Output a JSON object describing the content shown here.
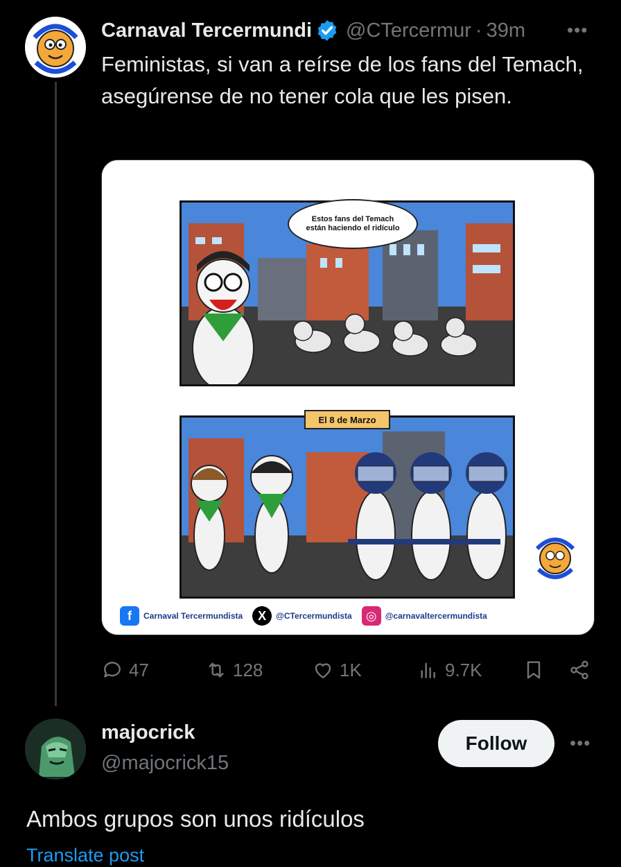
{
  "post": {
    "display_name": "Carnaval Tercermundista",
    "handle": "@CTercermur",
    "separator": "·",
    "time": "39m",
    "text": "Feministas, si van a reírse de los fans del Temach, asegúrense de no tener cola que les pisen.",
    "avatar_icon": "carnaval-logo-avatar",
    "verified_icon": "verified-badge-icon",
    "media": {
      "bubble_text": "Estos fans del Temach están haciendo el ridículo",
      "date_tag": "El 8 de Marzo",
      "social": [
        {
          "icon": "facebook-icon",
          "label": "Carnaval Tercermundista"
        },
        {
          "icon": "x-logo-icon",
          "label": "@CTercermundista"
        },
        {
          "icon": "instagram-icon",
          "label": "@carnavaltercermundista"
        }
      ]
    },
    "actions": {
      "replies": "47",
      "reposts": "128",
      "likes": "1K",
      "views": "9.7K"
    }
  },
  "reply": {
    "display_name": "majocrick",
    "handle": "@majocrick15",
    "follow_label": "Follow",
    "text": "Ambos grupos son unos ridículos",
    "translate_label": "Translate post",
    "avatar_icon": "green-character-avatar"
  },
  "colors": {
    "background": "#000000",
    "primary_text": "#e7e9ea",
    "secondary_text": "#71767b",
    "accent": "#1d9bf0"
  }
}
